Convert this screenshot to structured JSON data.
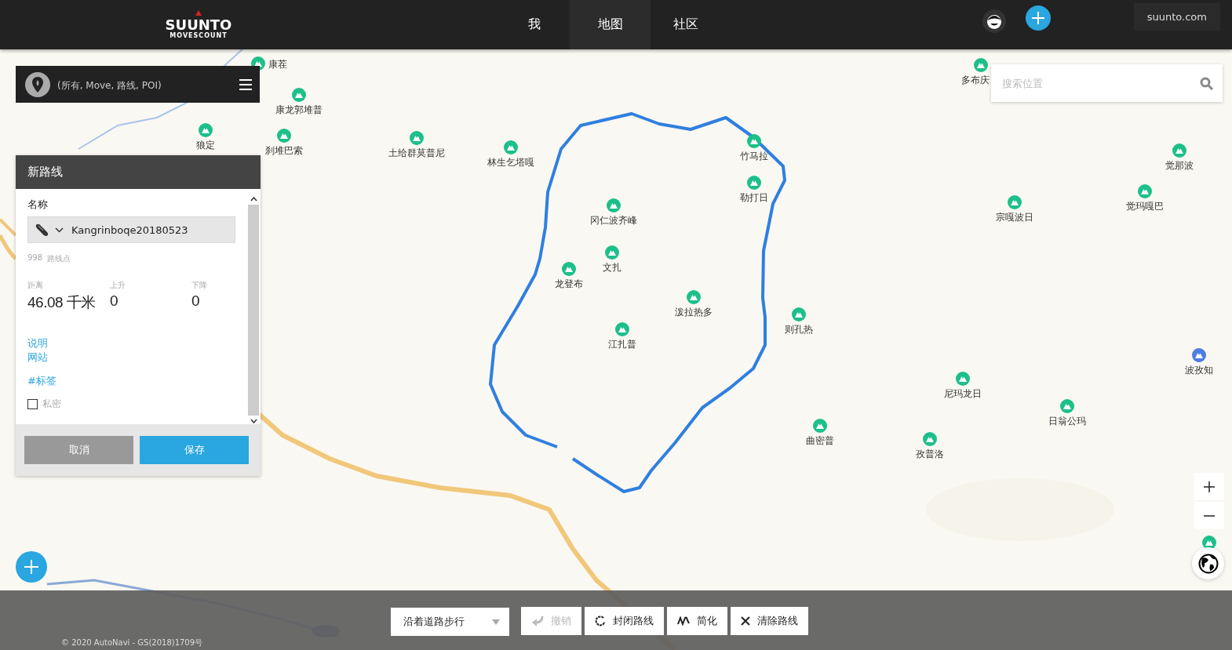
{
  "header": {
    "logo": {
      "brand": "SUUNTO",
      "sub": "MOVESCOUNT"
    },
    "tabs": [
      {
        "label": "我",
        "selected": false
      },
      {
        "label": "地图",
        "selected": true
      },
      {
        "label": "社区",
        "selected": false
      }
    ],
    "site_link": "suunto.com"
  },
  "filter_bar": {
    "text": "(所有, Move, 路线, POI)"
  },
  "search": {
    "placeholder": "搜索位置"
  },
  "pois": [
    {
      "name": "康茬",
      "kind": "label_right",
      "color": "#1dbf8a"
    },
    {
      "name": "康龙郭堆普",
      "kind": "label_below",
      "color": "#1dbf8a"
    },
    {
      "name": "狼定",
      "kind": "label_below",
      "color": "#1dbf8a"
    },
    {
      "name": "刹堆巴索",
      "kind": "label_below",
      "color": "#1dbf8a"
    },
    {
      "name": "土给群莫普尼",
      "kind": "label_below",
      "color": "#1dbf8a"
    },
    {
      "name": "林生乞塔嘎",
      "kind": "label_below",
      "color": "#1dbf8a"
    },
    {
      "name": "竹马拉",
      "kind": "label_below",
      "color": "#1dbf8a"
    },
    {
      "name": "勒打日",
      "kind": "label_below",
      "color": "#1dbf8a"
    },
    {
      "name": "冈仁波齐峰",
      "kind": "label_below",
      "color": "#1dbf8a"
    },
    {
      "name": "文扎",
      "kind": "label_below",
      "color": "#1dbf8a"
    },
    {
      "name": "龙登布",
      "kind": "label_below",
      "color": "#1dbf8a"
    },
    {
      "name": "泼拉热多",
      "kind": "label_below",
      "color": "#1dbf8a"
    },
    {
      "name": "江扎普",
      "kind": "label_below",
      "color": "#1dbf8a"
    },
    {
      "name": "则孔热",
      "kind": "label_below",
      "color": "#1dbf8a"
    },
    {
      "name": "多布庆",
      "kind": "label_below",
      "color": "#1dbf8a"
    },
    {
      "name": "觉那波",
      "kind": "label_below",
      "color": "#1dbf8a"
    },
    {
      "name": "宗嘎波日",
      "kind": "label_below",
      "color": "#1dbf8a"
    },
    {
      "name": "觉玛嘎巴",
      "kind": "label_below",
      "color": "#1dbf8a"
    },
    {
      "name": "波孜知",
      "kind": "label_below",
      "color": "#4d7de0"
    },
    {
      "name": "尼玛龙日",
      "kind": "label_below",
      "color": "#1dbf8a"
    },
    {
      "name": "日翁公玛",
      "kind": "label_below",
      "color": "#1dbf8a"
    },
    {
      "name": "曲密普",
      "kind": "label_below",
      "color": "#1dbf8a"
    },
    {
      "name": "孜普洛",
      "kind": "label_below",
      "color": "#1dbf8a"
    },
    {
      "kind": "icon_only",
      "color": "#1dbf8a"
    }
  ],
  "panel": {
    "title": "新路线",
    "name_label": "名称",
    "name_value": "Kangrinboqe20180523",
    "point_count": "998",
    "point_label": "路线点",
    "stats": [
      {
        "label": "距离",
        "value": "46.08 千米"
      },
      {
        "label": "上升",
        "value": "0"
      },
      {
        "label": "下降",
        "value": "0"
      }
    ],
    "links": [
      "说明",
      "网站"
    ],
    "tag_link": "#标签",
    "private": {
      "label": "私密",
      "checked": false
    },
    "buttons": [
      {
        "label": "取消",
        "kind": "cancel"
      },
      {
        "label": "保存",
        "kind": "save"
      }
    ]
  },
  "toolbar": {
    "mode": "沿着道路步行",
    "buttons": [
      {
        "label": "撤销",
        "kind": "undo",
        "disabled": true
      },
      {
        "label": "封闭路线",
        "kind": "close",
        "disabled": false
      },
      {
        "label": "简化",
        "kind": "simplify",
        "disabled": false
      },
      {
        "label": "清除路线",
        "kind": "clear",
        "disabled": false
      }
    ]
  },
  "attribution": "© 2020 AutoNavi - GS(2018)1709号"
}
